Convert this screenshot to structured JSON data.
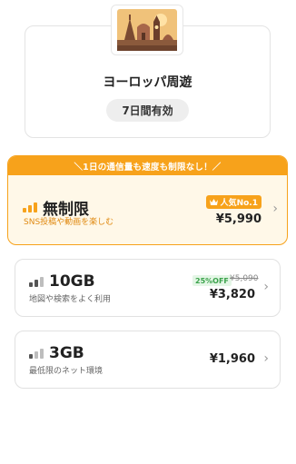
{
  "product": {
    "title": "ヨーロッパ周遊",
    "validity": "7日間有効",
    "image_icon": "europe-landmarks-illustration"
  },
  "plans": {
    "featured_banner": "＼1日の通信量も速度も制限なし！／",
    "unlimited": {
      "name": "無制限",
      "description": "SNS投稿や動画を楽しむ",
      "badge": "人気No.1",
      "price": "¥5,990",
      "accent_color": "#f7a21b"
    },
    "gb10": {
      "name": "10GB",
      "description": "地図や検索をよく利用",
      "discount": "25%OFF",
      "old_price": "¥5,090",
      "price": "¥3,820"
    },
    "gb3": {
      "name": "3GB",
      "description": "最低限のネット環境",
      "price": "¥1,960"
    }
  },
  "icons": {
    "signal": "signal-bars-icon",
    "chevron": "chevron-right-icon",
    "crown": "crown-icon"
  },
  "colors": {
    "accent": "#f7a21b",
    "featured_background": "#fff8e8",
    "discount_green": "#3aa24a"
  }
}
